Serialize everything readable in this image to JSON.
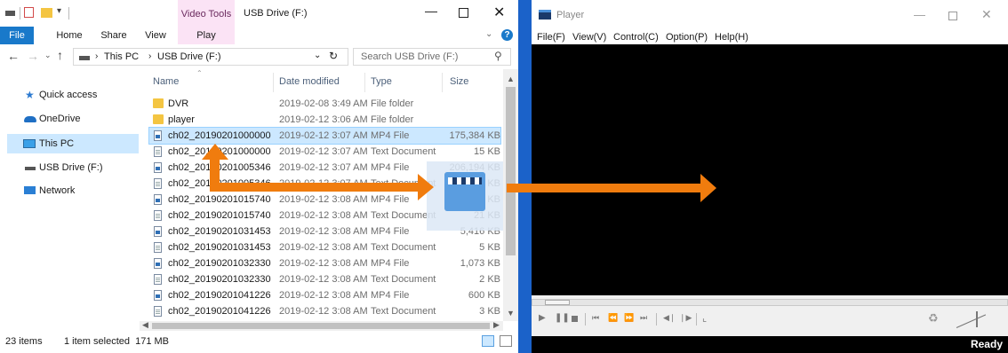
{
  "explorer": {
    "title": "USB Drive (F:)",
    "contextual_tab": "Video Tools",
    "ribbon_tabs": [
      "File",
      "Home",
      "Share",
      "View",
      "Play"
    ],
    "address": {
      "path": [
        "This PC",
        "USB Drive (F:)"
      ],
      "search_placeholder": "Search USB Drive (F:)"
    },
    "nav": {
      "quick_access": "Quick access",
      "onedrive": "OneDrive",
      "this_pc": "This PC",
      "usb_drive": "USB Drive (F:)",
      "network": "Network"
    },
    "columns": {
      "name": "Name",
      "date": "Date modified",
      "type": "Type",
      "size": "Size"
    },
    "files": [
      {
        "name": "DVR",
        "date": "2019-02-08 3:49 AM",
        "type": "File folder",
        "size": "",
        "icon": "folder"
      },
      {
        "name": "player",
        "date": "2019-02-12 3:06 AM",
        "type": "File folder",
        "size": "",
        "icon": "folder"
      },
      {
        "name": "ch02_20190201000000",
        "date": "2019-02-12 3:07 AM",
        "type": "MP4 File",
        "size": "175,384 KB",
        "icon": "mp4",
        "selected": true
      },
      {
        "name": "ch02_20190201000000",
        "date": "2019-02-12 3:07 AM",
        "type": "Text Document",
        "size": "15 KB",
        "icon": "txt"
      },
      {
        "name": "ch02_20190201005346",
        "date": "2019-02-12 3:07 AM",
        "type": "MP4 File",
        "size": "206,194 KB",
        "icon": "mp4"
      },
      {
        "name": "ch02_20190201005346",
        "date": "2019-02-12 3:07 AM",
        "type": "Text Document",
        "size": "6 KB",
        "icon": "txt"
      },
      {
        "name": "ch02_20190201015740",
        "date": "2019-02-12 3:08 AM",
        "type": "MP4 File",
        "size": "227,481 KB",
        "icon": "mp4"
      },
      {
        "name": "ch02_20190201015740",
        "date": "2019-02-12 3:08 AM",
        "type": "Text Document",
        "size": "21 KB",
        "icon": "txt"
      },
      {
        "name": "ch02_20190201031453",
        "date": "2019-02-12 3:08 AM",
        "type": "MP4 File",
        "size": "5,416 KB",
        "icon": "mp4"
      },
      {
        "name": "ch02_20190201031453",
        "date": "2019-02-12 3:08 AM",
        "type": "Text Document",
        "size": "5 KB",
        "icon": "txt"
      },
      {
        "name": "ch02_20190201032330",
        "date": "2019-02-12 3:08 AM",
        "type": "MP4 File",
        "size": "1,073 KB",
        "icon": "mp4"
      },
      {
        "name": "ch02_20190201032330",
        "date": "2019-02-12 3:08 AM",
        "type": "Text Document",
        "size": "2 KB",
        "icon": "txt"
      },
      {
        "name": "ch02_20190201041226",
        "date": "2019-02-12 3:08 AM",
        "type": "MP4 File",
        "size": "600 KB",
        "icon": "mp4"
      },
      {
        "name": "ch02_20190201041226",
        "date": "2019-02-12 3:08 AM",
        "type": "Text Document",
        "size": "3 KB",
        "icon": "txt"
      }
    ],
    "status": {
      "items": "23 items",
      "selected": "1 item selected  171 MB"
    }
  },
  "player": {
    "title": "Player",
    "menu": [
      "File(F)",
      "View(V)",
      "Control(C)",
      "Option(P)",
      "Help(H)"
    ],
    "status": "Ready"
  },
  "colors": {
    "arrow": "#f07c0e",
    "divider": "#1b62c9",
    "selection": "#cce8ff"
  }
}
